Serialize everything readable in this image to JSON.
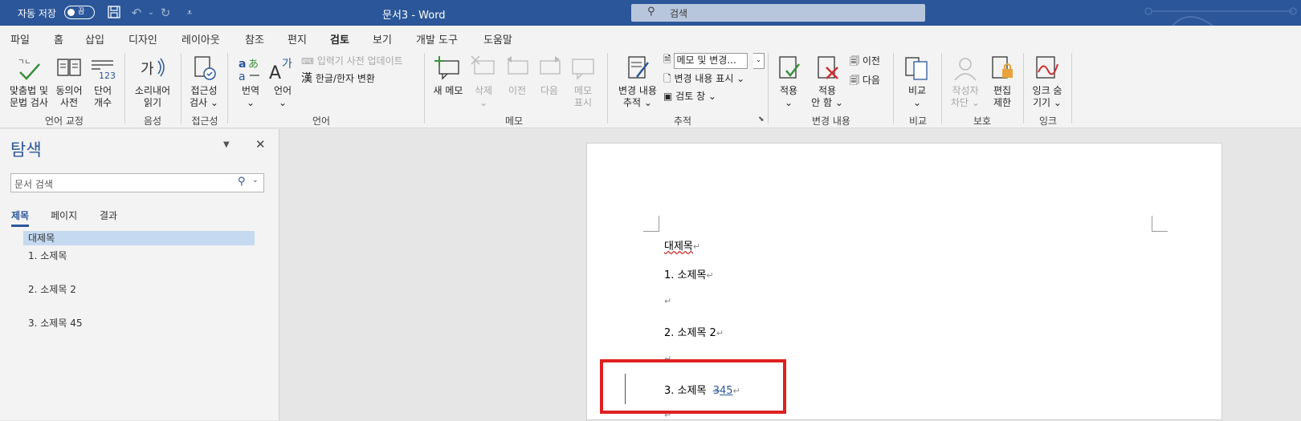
{
  "titlebar": {
    "autosave_label": "자동 저장",
    "autosave_state": "끔",
    "doc_title": "문서3  -  Word",
    "search_placeholder": "검색"
  },
  "tabs": [
    "파일",
    "홈",
    "삽입",
    "디자인",
    "레이아웃",
    "참조",
    "편지",
    "검토",
    "보기",
    "개발 도구",
    "도움말"
  ],
  "active_tab": "검토",
  "ribbon": {
    "proofing": {
      "spell": "맞춤법 및\n문법 검사",
      "thesaurus": "동의어\n사전",
      "wordcount": "단어\n개수",
      "group": "언어 교정"
    },
    "speech": {
      "read": "소리내어\n읽기",
      "group": "음성"
    },
    "accessibility": {
      "check": "접근성\n검사 ⌄",
      "group": "접근성"
    },
    "language": {
      "translate": "번역\n⌄",
      "language": "언어\n⌄",
      "ime_update": "입력기 사전 업데이트",
      "hanja": "한글/한자 변환",
      "group": "언어"
    },
    "comments": {
      "new": "새 메모",
      "delete": "삭제\n⌄",
      "prev": "이전",
      "next": "다음",
      "show": "메모\n표시",
      "group": "메모"
    },
    "tracking": {
      "track": "변경 내용\n추적 ⌄",
      "markup_select": "메모 및 변경...",
      "show_markup": "변경 내용 표시 ⌄",
      "review_pane": "검토 창  ⌄",
      "group": "추적"
    },
    "changes": {
      "accept": "적용\n⌄",
      "reject": "적용\n안 함 ⌄",
      "prev": "이전",
      "next": "다음",
      "group": "변경 내용"
    },
    "compare": {
      "compare": "비교\n⌄",
      "group": "비교"
    },
    "protect": {
      "block_authors": "작성자\n차단 ⌄",
      "restrict": "편집\n제한",
      "group": "보호"
    },
    "ink": {
      "hide_ink": "잉크 숨\n기기 ⌄",
      "group": "잉크"
    }
  },
  "navpane": {
    "title": "탐색",
    "search_placeholder": "문서 검색",
    "tabs": [
      "제목",
      "페이지",
      "결과"
    ],
    "headings": [
      "대제목",
      "1. 소제목",
      "2. 소제목 2",
      "3. 소제목 45"
    ]
  },
  "document": {
    "heading": "대제목",
    "item1": "1. 소제목",
    "item2": "2. 소제목  2",
    "item3_prefix": "3. 소제목  ",
    "item3_deleted": "3",
    "item3_inserted": "45",
    "para_mark": "↵"
  },
  "colors": {
    "accent": "#2b579a",
    "highlight_box": "#e02020"
  }
}
